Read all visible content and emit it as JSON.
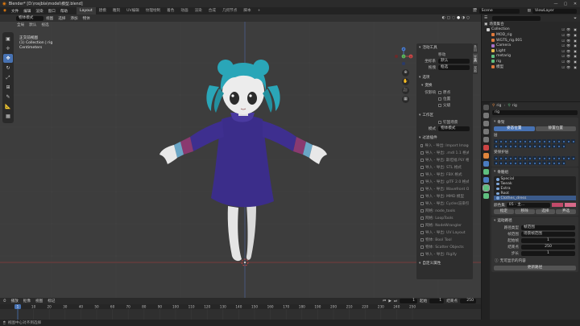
{
  "window": {
    "title": "Blender* [D:\\rosjbla\\model\\模型.blend]",
    "controls": [
      "—",
      "▢",
      "✕"
    ]
  },
  "menu": {
    "items": [
      "文件",
      "编辑",
      "渲染",
      "窗口",
      "帮助"
    ],
    "workspaces": [
      "Layout",
      "建模",
      "雕刻",
      "UV编辑",
      "纹理绘制",
      "着色",
      "动画",
      "渲染",
      "合成",
      "几何节点",
      "脚本"
    ],
    "active_workspace": "Layout",
    "add_tab": "+",
    "scene_label": "Scene",
    "view_layer_label": "ViewLayer"
  },
  "viewport": {
    "header_items": [
      "物体模式",
      "视图",
      "选择",
      "添加",
      "物体"
    ],
    "header2_items": [
      "全局",
      "默认",
      "视选"
    ],
    "info_line1": "正交前视图",
    "info_line2": "(1) Collection | rig",
    "info_line3": "Centimeters",
    "tools": [
      {
        "name": "select-box-tool",
        "glyph": "▣",
        "active": false
      },
      {
        "name": "cursor-tool",
        "glyph": "✛",
        "active": false
      },
      {
        "name": "move-tool",
        "glyph": "✥",
        "active": true
      },
      {
        "name": "rotate-tool",
        "glyph": "↻",
        "active": false
      },
      {
        "name": "scale-tool",
        "glyph": "⤢",
        "active": false
      },
      {
        "name": "transform-tool",
        "glyph": "⊞",
        "active": false
      },
      {
        "name": "annotate-tool",
        "glyph": "✎",
        "active": false
      },
      {
        "name": "measure-tool",
        "glyph": "📐",
        "active": false
      },
      {
        "name": "add-cube-tool",
        "glyph": "▦",
        "active": false
      }
    ],
    "nav_buttons": [
      "⊕",
      "✋",
      "🎥",
      "▦"
    ],
    "gizmo_axes": {
      "x": "X",
      "y": "Y",
      "z": "Z"
    }
  },
  "npanel": {
    "tabs": [
      "条目",
      "工具",
      "视图"
    ],
    "active_tool_title": "活动工具",
    "active_tool_name": "移动",
    "orientation_label": "坐标系",
    "orientation_value": "默认",
    "drag_label": "拖拽",
    "drag_value": "框选",
    "options_title": "选项",
    "transform_title": "变换",
    "affect_only_label": "仅影响",
    "affect_origins": "原点",
    "affect_positions": "位置",
    "affect_parents": "父级",
    "workspace_title": "工作区",
    "pin_scene": "钉固场景",
    "mode_label": "模式",
    "mode_value": "物体模式",
    "filter_addons_title": "过滤插件",
    "addons": [
      "导入 - 导出: Import Images as Planes",
      "导入 - 导出: .mdl 1.1 格式",
      "导入 - 导出: 斯坦福 PLY 格式",
      "导入 - 导出: STL 格式",
      "导入 - 导出: FBX 格式",
      "导入 - 导出: glTF 2.0 格式",
      "导入 - 导出: Wavefront OBJ",
      "导入 - 导出: MMD 模型",
      "导入 - 导出: Cycles渲染引擎",
      "网格: node_tools",
      "网格: LoopTools",
      "网格: NodeWrangler",
      "导入 - 导出: UV Layout",
      "物体: Bool Tool",
      "物体: Scatter Objects",
      "导入 - 导出: Rigify"
    ],
    "custom_props_title": "自定义属性"
  },
  "timeline": {
    "header_items": [
      "播放",
      "抠像",
      "视图",
      "标记"
    ],
    "current_frame": "1",
    "start_label": "起始",
    "start_value": "1",
    "end_label": "结束点",
    "end_value": "250",
    "ruler_ticks": [
      "1",
      "10",
      "20",
      "30",
      "40",
      "50",
      "60",
      "70",
      "80",
      "90",
      "100",
      "110",
      "120",
      "130",
      "140",
      "150",
      "160",
      "170",
      "180",
      "190",
      "200",
      "210",
      "220",
      "230",
      "240",
      "250"
    ]
  },
  "statusbar": {
    "text": "视图中心对齐到选择"
  },
  "outliner": {
    "title": "场景集合",
    "items": [
      {
        "label": "Collection",
        "color": "#d0d0d0",
        "indent": 0
      },
      {
        "label": "MOD_rig",
        "color": "#e07a3c",
        "indent": 1
      },
      {
        "label": "WGTS_rig.001",
        "color": "#e07a3c",
        "indent": 1
      },
      {
        "label": "Camera",
        "color": "#a872c9",
        "indent": 1
      },
      {
        "label": "Light",
        "color": "#e0b64a",
        "indent": 1
      },
      {
        "label": "metarig",
        "color": "#5fbf7f",
        "indent": 1
      },
      {
        "label": "rig",
        "color": "#5fbf7f",
        "indent": 1
      },
      {
        "label": "模型",
        "color": "#e07a3c",
        "indent": 1
      }
    ]
  },
  "properties": {
    "breadcrumb_object": "rig",
    "breadcrumb_data": "rig",
    "data_name": "rig",
    "pose_title": "骨架",
    "pose_position": "姿态位置",
    "rest_position": "静置位置",
    "layers_label": "层",
    "protected_label": "受保护层",
    "bone_groups_title": "骨骼组",
    "bone_groups": [
      "Special",
      "Tweak",
      "Extra",
      "Root",
      "Clothes_dress"
    ],
    "active_group": "Clothes_dress",
    "color_set_label": "颜色集",
    "color_set_value": "05 - 主...",
    "assign_btn": "指定",
    "remove_btn": "移除",
    "select_btn": "选择",
    "deselect_btn": "弃选",
    "motion_paths_title": "运动路径",
    "paths_type_label": "路径类型",
    "paths_type_value": "帧范围",
    "frame_range_label": "帧范围",
    "frame_range_value": "场景帧范围",
    "frame_start_label": "起始帧",
    "frame_start_value": "1",
    "frame_end_label": "结束点",
    "frame_end_value": "250",
    "step_label": "步长",
    "step_value": "1",
    "warning_text": "无可显示的内容",
    "update_btn": "更新路径"
  },
  "colors": {
    "accent": "#4772b3",
    "bg": "#3d3d3d",
    "panel": "#2e2e2e",
    "dress": "#3b2d8a",
    "hair": "#2aa6b8",
    "skin": "#e8e8e8"
  }
}
